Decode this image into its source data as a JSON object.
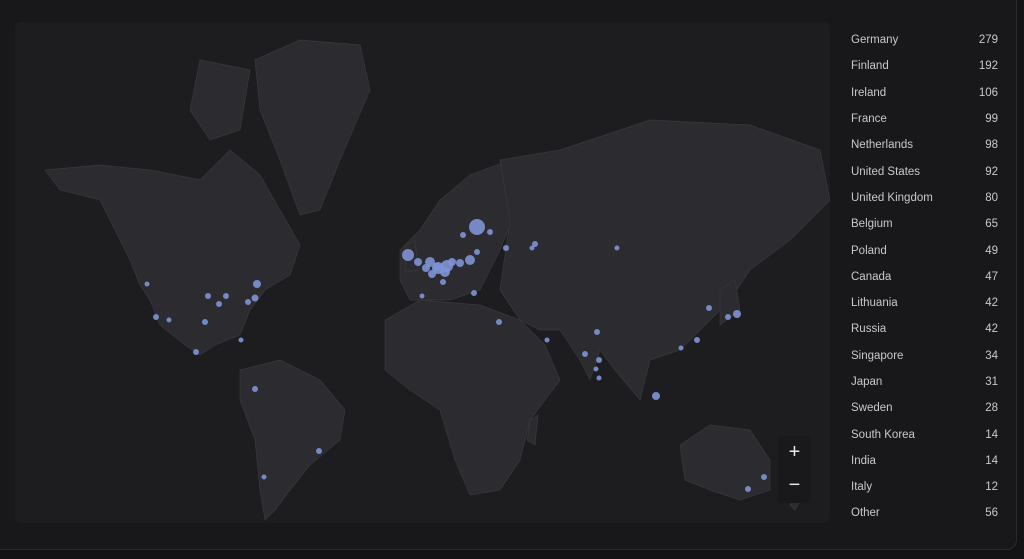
{
  "map": {
    "zoom_in_label": "+",
    "zoom_out_label": "−",
    "marker_color": "#8093d6",
    "land_color": "#2b2b30",
    "ocean_color": "#1d1d20"
  },
  "countries": [
    {
      "name": "Germany",
      "count": "279"
    },
    {
      "name": "Finland",
      "count": "192"
    },
    {
      "name": "Ireland",
      "count": "106"
    },
    {
      "name": "France",
      "count": "99"
    },
    {
      "name": "Netherlands",
      "count": "98"
    },
    {
      "name": "United States",
      "count": "92"
    },
    {
      "name": "United Kingdom",
      "count": "80"
    },
    {
      "name": "Belgium",
      "count": "65"
    },
    {
      "name": "Poland",
      "count": "49"
    },
    {
      "name": "Canada",
      "count": "47"
    },
    {
      "name": "Lithuania",
      "count": "42"
    },
    {
      "name": "Russia",
      "count": "42"
    },
    {
      "name": "Singapore",
      "count": "34"
    },
    {
      "name": "Japan",
      "count": "31"
    },
    {
      "name": "Sweden",
      "count": "28"
    },
    {
      "name": "South Korea",
      "count": "14"
    },
    {
      "name": "India",
      "count": "14"
    },
    {
      "name": "Italy",
      "count": "12"
    },
    {
      "name": "Other",
      "count": "56"
    }
  ]
}
